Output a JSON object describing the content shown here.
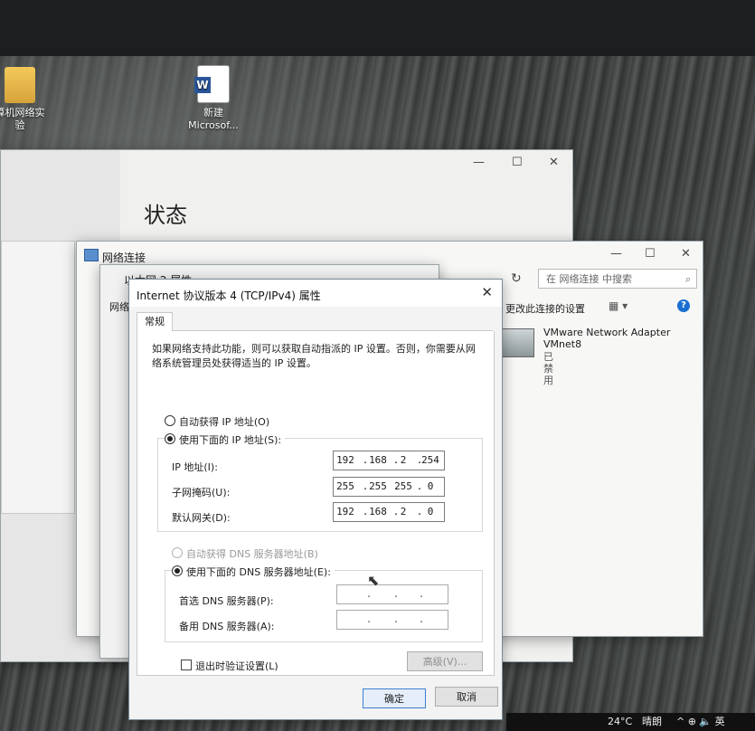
{
  "desktop": {
    "icons": [
      {
        "label": "算机网络实\n验",
        "icon": "folder-icon"
      },
      {
        "label": "新建\nMicrosof...",
        "icon": "word-document-icon"
      }
    ]
  },
  "settings_window": {
    "title": "状态",
    "controls": {
      "minimize": "—",
      "maximize": "☐",
      "close": "✕"
    }
  },
  "network_connections": {
    "title": "网络连接",
    "search_placeholder": "在 网络连接 中搜索",
    "command": "更改此连接的设置",
    "refresh": "↻",
    "search_icon": "⌕",
    "help": "?",
    "view_icons": "▦ ▾",
    "adapter": {
      "name": "VMware Network Adapter",
      "sub": "VMnet8",
      "state": "已禁用"
    },
    "controls": {
      "minimize": "—",
      "maximize": "☐",
      "close": "✕"
    }
  },
  "ethernet_properties": {
    "title": "以太网 2 属性",
    "tab": "网络"
  },
  "ipv4_dialog": {
    "title": "Internet 协议版本 4 (TCP/IPv4) 属性",
    "close": "✕",
    "tab_general": "常规",
    "description": "如果网络支持此功能，则可以获取自动指派的 IP 设置。否则，你需要从网络系统管理员处获得适当的 IP 设置。",
    "auto_ip_label": "自动获得 IP 地址(O)",
    "manual_ip_label": "使用下面的 IP 地址(S):",
    "ip_address_label": "IP 地址(I):",
    "ip_address": [
      "192",
      "168",
      "2",
      "254"
    ],
    "subnet_label": "子网掩码(U):",
    "subnet": [
      "255",
      "255",
      "255",
      "0"
    ],
    "gateway_label": "默认网关(D):",
    "gateway": [
      "192",
      "168",
      "2",
      "0"
    ],
    "auto_dns_label": "自动获得 DNS 服务器地址(B)",
    "manual_dns_label": "使用下面的 DNS 服务器地址(E):",
    "preferred_dns_label": "首选 DNS 服务器(P):",
    "preferred_dns": [
      ".",
      ".",
      "."
    ],
    "alternate_dns_label": "备用 DNS 服务器(A):",
    "alternate_dns": [
      ".",
      ".",
      "."
    ],
    "validate_label": "退出时验证设置(L)",
    "advanced_button": "高级(V)...",
    "ok_button": "确定",
    "cancel_button": "取消",
    "ip_mode": "manual",
    "dns_mode": "manual",
    "validate_checked": false
  },
  "taskbar": {
    "temperature": "24°C",
    "weather": "晴朗",
    "tray": "^ ⊕ 🔈 英"
  }
}
